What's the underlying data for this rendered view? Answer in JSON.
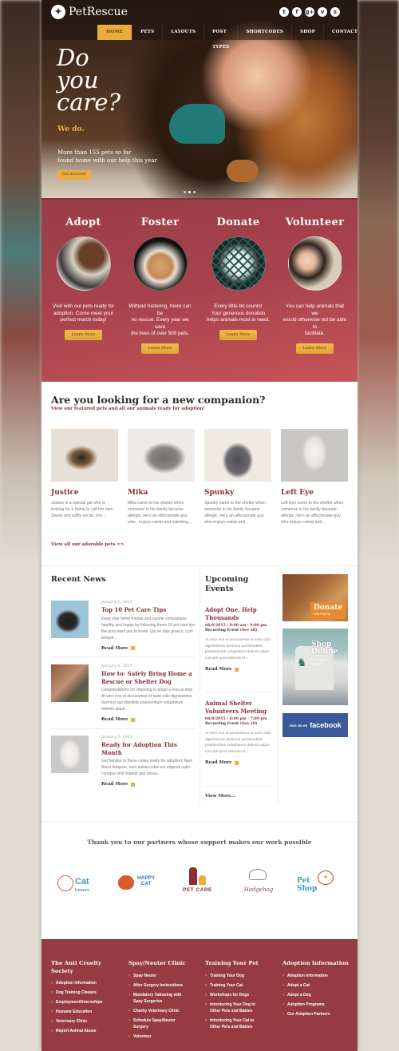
{
  "header": {
    "brand": "PetRescue",
    "social_icons": [
      {
        "name": "twitter-icon",
        "glyph": "t"
      },
      {
        "name": "facebook-icon",
        "glyph": "f"
      },
      {
        "name": "google-plus-icon",
        "glyph": "g+"
      },
      {
        "name": "vimeo-icon",
        "glyph": "v"
      },
      {
        "name": "skype-icon",
        "glyph": "s"
      }
    ],
    "nav": [
      "HOME",
      "PETS",
      "LAYOUTS",
      "POST TYPES",
      "SHORTCODES",
      "SHOP",
      "CONTACTS"
    ],
    "nav_active": "HOME"
  },
  "hero": {
    "title": "Do\nyou\ncare?",
    "subtitle": "We do.",
    "text": "More than 155 pets so far\nfound home with our help this year",
    "button": "Get involved!",
    "slides": 3,
    "active_slide": 1
  },
  "help": {
    "accent": "#e9ad3e",
    "columns": [
      {
        "title": "Adopt",
        "text": "Visit with our pets ready for\nadoption. Come meet your\nperfect match today!",
        "button": "Learn More"
      },
      {
        "title": "Foster",
        "text": "Without fostering, there can\nbe\nno rescue. Every year we\nsave\nthe lives of over 500 pets.",
        "button": "Learn More"
      },
      {
        "title": "Donate",
        "text": "Every little bit counts!\nYour generous donation\nhelps animals most in need.",
        "button": "Learn More"
      },
      {
        "title": "Volunteer",
        "text": "You can help animals that\nwe\nwould otherwise not be able\nto\nfacilitate.",
        "button": "Learn More"
      }
    ]
  },
  "companion": {
    "title": "Are you looking for a new companion?",
    "subtitle": "View our featured pets and all our animals ready for adoption!",
    "pets": [
      {
        "name": "Justice",
        "desc": "Justice is a special gal who is looking for a home to call her own. Sweet and softly social, she..."
      },
      {
        "name": "Mika",
        "desc": "Mika came to the shelter when someone in his family became allergic. He's an affectionate guy who.. enjoys catnip and watching..."
      },
      {
        "name": "Spunky",
        "desc": "Spunky came to the shelter when someone in his family became allergic. He's an affectionate guy who enjoys catnip and..."
      },
      {
        "name": "Left Eye",
        "desc": "Left Eye came to the shelter when someone in his family became allergic. He's an affectionate guy who enjoys catnip and..."
      }
    ],
    "view_all": "View all our adorable pets >>"
  },
  "news": {
    "title": "Recent News",
    "read_more": "Read More",
    "items": [
      {
        "date": "January 1, 2015",
        "title": "Top 10 Pet Care Tips",
        "text": "Keep your feline friends and canine companions healthy and happy by following these 10 pet care tips the pros want you to know. Qui ne duis graeco, cum tempor..."
      },
      {
        "date": "January 9, 2015",
        "title": "How to: Safely Bring Home a Rescue or Shelter Dog",
        "text": "Congratulations on choosing to adopt a rescue dog! At vero eos et accusamus et iusto odio dignissimos ducimus qui blanditiis praesentium voluptatum deleniti atque ..."
      },
      {
        "date": "January 5, 2015",
        "title": "Ready for Adoption This Month",
        "text": "Get familiar to these cuties ready for adoption! Nam libero tempore, cum soluta nobis est eligendi optio cumque nihil impedit quo minus..."
      }
    ]
  },
  "events": {
    "title": "Upcoming\nEvents",
    "read_more": "Read More",
    "view_more": "View More...",
    "items": [
      {
        "title": "Adopt One. Help Thousands",
        "time": "06/6/2015 / 8:00 am - 8:00 pm",
        "recurring": "Recurring Event",
        "see_all": "(See all)",
        "text": "At vero eos et accusamus et iusto odio dignissimos ducimus qui blanditiis praesentium voluptatum deleniti atque corrupti quos dolores et..."
      },
      {
        "title": "Animal Shelter Volunteers Meeting",
        "time": "06/8/2015 / 6:00 pm - 7:00 pm",
        "recurring": "Recurring Event",
        "see_all": "(See all)",
        "text": "At vero eos et accusamus et iusto odio dignissimos ducimus qui blanditiis praesentium voluptatum deleniti atque corrupti quos dolores et..."
      }
    ]
  },
  "ads": {
    "donate_title": "Donate",
    "donate_sub": "with PayPal",
    "shop_title": "Shop\nOnline",
    "shop_sub": "Show your\nsupport",
    "fb_prefix": "Join Us on",
    "fb_brand": "facebook"
  },
  "partners": {
    "title": "Thank you to our partners whose support makes our work possible",
    "logos": [
      {
        "name": "Cat Lovers",
        "line1": "Cat",
        "line2": "Lovers"
      },
      {
        "name": "Happy Cat",
        "text": "HAPPY\nCAT"
      },
      {
        "name": "Pet Care",
        "text": "PET CARE"
      },
      {
        "name": "Hedgehog",
        "text": "Hedgehog"
      },
      {
        "name": "Pet Shop",
        "text": "Pet\nShop"
      }
    ]
  },
  "footer": {
    "columns": [
      {
        "title": "The Anti Cruelty\nSociety",
        "links": [
          "Adoption Information",
          "Dog Training Classes",
          "Employment/Internships",
          "Humane Education",
          "Veterinary Clinic",
          "Report Animal Abuse"
        ]
      },
      {
        "title": "Spay/Neuter Clinic",
        "links": [
          "Spay Neuter",
          "After Surgery Instructions",
          "Mandatory Tattooing with\nSpay Surgeries",
          "Charity Veterinary Clinic",
          "Schedule Spay/Neuter\nSurgery",
          "Volunteer"
        ]
      },
      {
        "title": "Training Your Pet",
        "links": [
          "Training Your Dog",
          "Training Your Cat",
          "Workshops for Dogs",
          "Introducing Your Dog to\nOther Pets and Babies",
          "Introducing Your Cat to\nOther Pets and Babies"
        ]
      },
      {
        "title": "Adoption Information",
        "links": [
          "Adoption Information",
          "Adopt a Cat",
          "Adopt a Dog",
          "Adoption Programs",
          "Our Adoption Partners"
        ]
      }
    ]
  },
  "colors": {
    "brand_red": "#953b41",
    "accent_gold": "#e9ad3e",
    "facebook_blue": "#3b5998"
  }
}
